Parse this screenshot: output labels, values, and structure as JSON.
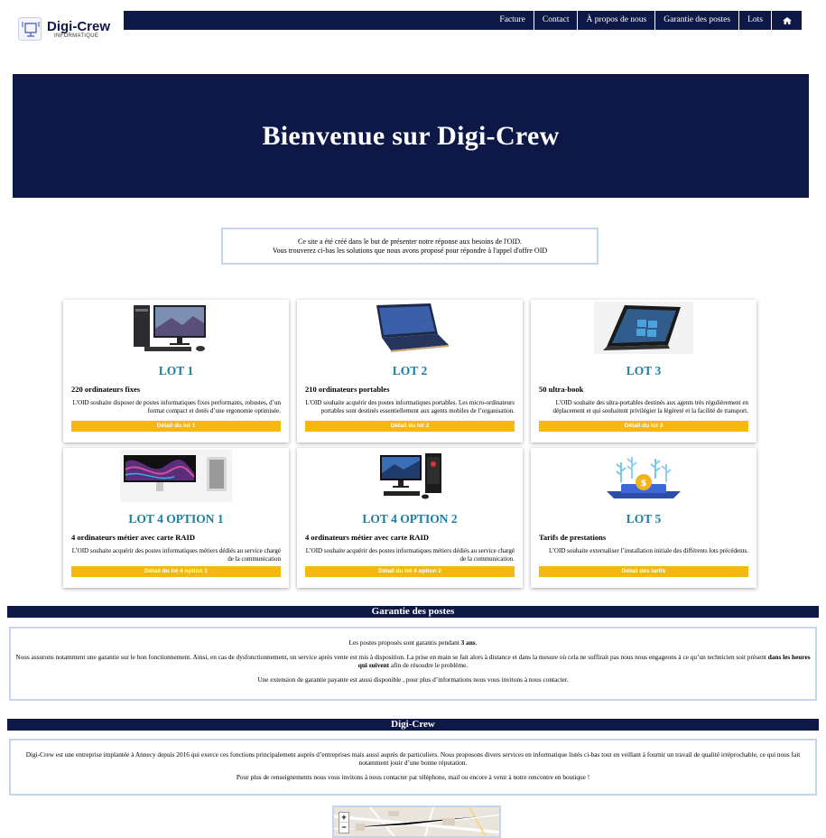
{
  "brand": {
    "name": "Digi-Crew",
    "subtitle": "INFORMATIQUE"
  },
  "nav": {
    "items": [
      "Facture",
      "Contact",
      "À propos de nous",
      "Garantie des postes",
      "Lots"
    ],
    "home_icon": "home-icon"
  },
  "hero": {
    "title": "Bienvenue sur Digi-Crew"
  },
  "intro": {
    "line1": "Ce site a été créé dans le but de présenter notre réponse aux besoins de l'OID.",
    "line2": "Vous trouverez ci-bas les solutions que nous avons proposé pour répondre à l'appel d'offre OID"
  },
  "lots": [
    {
      "title": "LOT 1",
      "subtitle": "220 ordinateurs fixes",
      "text": "L'OID souhaite disposer de postes informatiques fixes performants, robustes, d’un format compact et dotés d’une ergonomie optimisée.",
      "button": "Détail du lot 1",
      "image": "desktop-computer-image"
    },
    {
      "title": "LOT 2",
      "subtitle": "210 ordinateurs portables",
      "text": "L'OID souhaite acquérir des postes informatiques portables. Les micro-ordinateurs portables sont destinés essentiellement aux agents mobiles de l’organisation.",
      "button": "Détail du lot 2",
      "image": "laptop-image"
    },
    {
      "title": "LOT 3",
      "subtitle": "50 ultra-book",
      "text": "L'OID souhaite des ultra-portables destinés aux agents très régulièrement en déplacement et qui souhaitent privilégier la légèreté et la facilité de transport.",
      "button": "Détail du lot 3",
      "image": "ultrabook-image"
    },
    {
      "title": "LOT 4 OPTION 1",
      "subtitle": "4 ordinateurs métier avec carte RAID",
      "text": "L’OID souhaite acquérir des postes informatiques métiers dédiés au service chargé de la communication",
      "button": "Détail du lot 4 option 1",
      "image": "workstation-image"
    },
    {
      "title": "LOT 4 OPTION 2",
      "subtitle": "4 ordinateurs métier avec carte RAID",
      "text": "L’OID souhaite acquérir des postes informatiques métiers dédiés au service chargé de la communication.",
      "button": "Détail du lot 4 option 2",
      "image": "gaming-pc-image"
    },
    {
      "title": "LOT 5",
      "subtitle": "Tarifs de prestations",
      "text": "L’OID souhaite externaliser l’installation initiale des différents lots précédents.",
      "button": "Détail des tarifs",
      "image": "pricing-image"
    }
  ],
  "garantie": {
    "title": "Garantie des postes",
    "p1_before": "Les postes proposés sont garantis pendant ",
    "p1_bold": "3 ans",
    "p1_after": ".",
    "p2_before": "Nous assurons notamment une garantie sur le bon fonctionnement. Ainsi, en cas de dysfonctionnement, un service après vente est mis à disposition. La prise en main se fait alors à distance et dans la mesure où cela ne suffirait pas nous nous engageons à ce qu’un technicien soit présent ",
    "p2_bold": "dans les heures qui suivent",
    "p2_after": " afin de résoudre le problème.",
    "p3": "Une extension de garantie payante est aussi disponible , pour plus d’informations nous vous invitons à nous contacter."
  },
  "about": {
    "title": "Digi-Crew",
    "p1": "Digi-Crew est une entreprise implantée à Annecy depuis 2016 qui exerce ces fonctions principalement auprès d’entreprises mais aussi auprès de particuliers. Nous proposons divers services en informatique listés ci-bas tout en veillant à fournir un travail de qualité irréprochable, ce qui nous fait notamment jouir d’une bonne réputation.",
    "p2": "Pour plus de renseignements nous vous invitons à nous contacter par téléphone, mail ou encore à venir à notre rencontre en boutique !"
  },
  "map": {
    "zoom_in": "+",
    "zoom_out": "−"
  },
  "colors": {
    "navy": "#0d1847",
    "accent_blue": "#1b7ea3",
    "button_yellow": "#f6b70f",
    "border_blue": "#c6d4ef"
  }
}
